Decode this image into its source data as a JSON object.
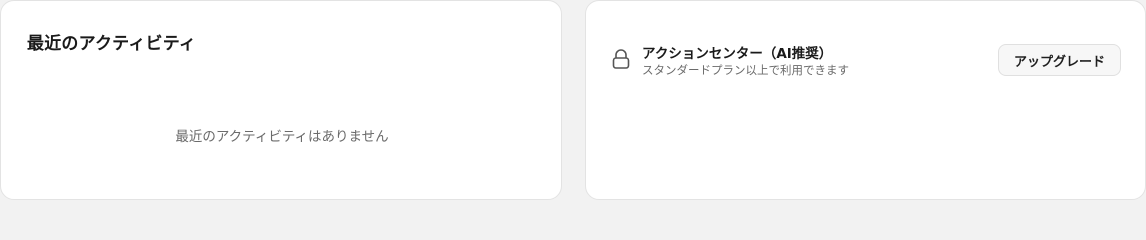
{
  "recent_activity": {
    "title": "最近のアクティビティ",
    "empty_message": "最近のアクティビティはありません"
  },
  "action_center": {
    "icon": "lock-icon",
    "title": "アクションセンター（AI推奨）",
    "subtitle": "スタンダードプラン以上で利用できます",
    "upgrade_label": "アップグレード"
  }
}
